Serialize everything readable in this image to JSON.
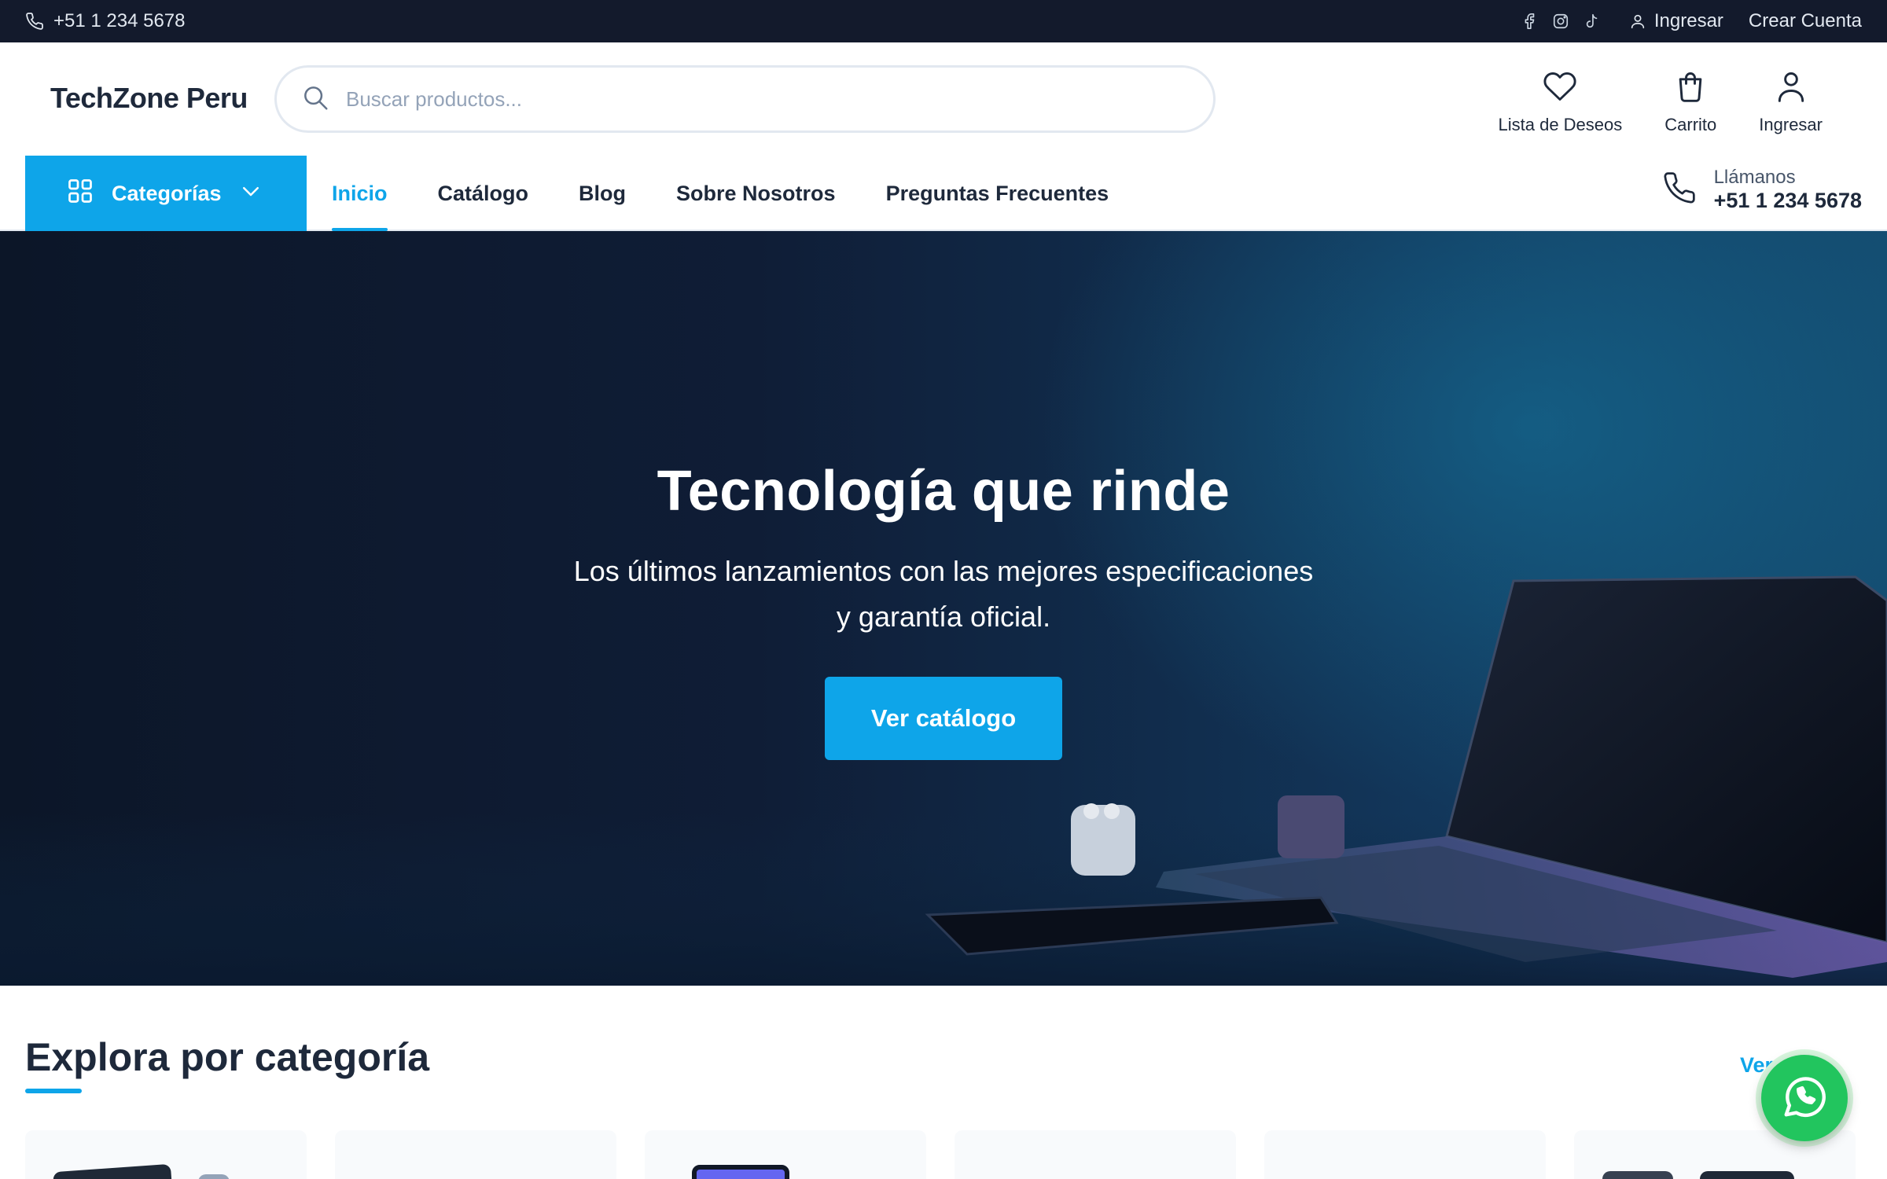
{
  "topbar": {
    "phone": "+51 1 234 5678",
    "social_icons": [
      "facebook-icon",
      "instagram-icon",
      "tiktok-icon"
    ],
    "login_label": "Ingresar",
    "register_label": "Crear Cuenta"
  },
  "header": {
    "logo": "TechZone Peru",
    "search_placeholder": "Buscar productos...",
    "icons": {
      "wishlist_label": "Lista de Deseos",
      "cart_label": "Carrito",
      "account_label": "Ingresar"
    }
  },
  "nav": {
    "categories_label": "Categorías",
    "items": [
      {
        "label": "Inicio",
        "active": true
      },
      {
        "label": "Catálogo",
        "active": false
      },
      {
        "label": "Blog",
        "active": false
      },
      {
        "label": "Sobre Nosotros",
        "active": false
      },
      {
        "label": "Preguntas Frecuentes",
        "active": false
      }
    ],
    "call_label": "Llámanos",
    "call_number": "+51 1 234 5678"
  },
  "hero": {
    "title": "Tecnología que rinde",
    "subtitle_line1": "Los últimos lanzamientos con las mejores especificaciones",
    "subtitle_line2": "y garantía oficial.",
    "cta_label": "Ver catálogo"
  },
  "categories_section": {
    "title": "Explora por categoría",
    "view_all_label": "Ver"
  },
  "colors": {
    "accent": "#0ea5e9",
    "topbar_bg": "#131a2c",
    "text_dark": "#1e293b",
    "whatsapp": "#22c55e"
  }
}
